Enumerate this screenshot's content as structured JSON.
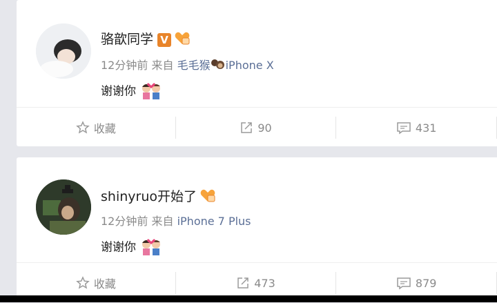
{
  "posts": [
    {
      "author": "骆歆同学",
      "badge_v": "V",
      "time": "12分钟前",
      "from_label": "来自",
      "client": "毛毛猴",
      "client_device": "iPhone X",
      "text": "谢谢你",
      "actions": {
        "favorite_label": "收藏",
        "repost_count": "90",
        "comment_count": "431"
      }
    },
    {
      "author": "shinyruo开始了",
      "time": "12分钟前",
      "from_label": "来自",
      "client_device": "iPhone 7 Plus",
      "text": "谢谢你",
      "actions": {
        "favorite_label": "收藏",
        "repost_count": "473",
        "comment_count": "879"
      }
    }
  ],
  "icons": {
    "favorite": "star-icon",
    "repost": "repost-icon",
    "comment": "comment-icon",
    "fan_badge": "fan-badge-icon",
    "emoji": "couple-heart-emoji",
    "client_icon": "monkey-icon"
  },
  "colors": {
    "accent_orange": "#e8842a",
    "link_blue": "#5b6f96",
    "meta_gray": "#8a8a8a"
  }
}
